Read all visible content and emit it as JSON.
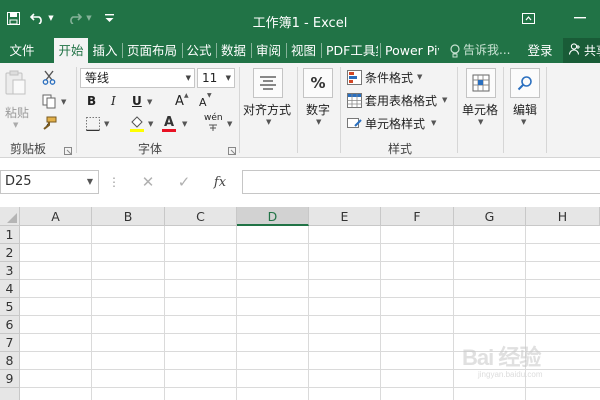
{
  "window": {
    "title": "工作簿1 - Excel",
    "accent_color": "#217346",
    "quick_access": {
      "save_icon": "save-icon",
      "undo_icon": "undo-icon",
      "redo_icon": "redo-icon",
      "customize_icon": "customize-qat-icon"
    },
    "controls": {
      "ribbon_display_icon": "ribbon-display-options-icon",
      "minimize_icon": "minimize-icon"
    }
  },
  "tabs": {
    "items": [
      "文件",
      "开始",
      "插入",
      "页面布局",
      "公式",
      "数据",
      "审阅",
      "视图",
      "PDF工具集",
      "Power Pivot"
    ],
    "active": "开始",
    "tell_me": "告诉我...",
    "sign_in": "登录",
    "share": "共享"
  },
  "ribbon": {
    "clipboard": {
      "label": "剪贴板",
      "paste": "粘贴"
    },
    "font": {
      "label": "字体",
      "font_name": "等线",
      "font_size": "11",
      "bold": "B",
      "italic": "I",
      "underline": "U",
      "grow": "A",
      "shrink": "A",
      "font_color_letter": "A",
      "phonetic": "wén",
      "fill_color": "#ffff00",
      "font_color": "#e81123"
    },
    "alignment": {
      "label": "对齐方式"
    },
    "number": {
      "label": "数字",
      "symbol": "%"
    },
    "styles": {
      "label": "样式",
      "conditional_formatting": "条件格式",
      "format_as_table": "套用表格格式",
      "cell_styles": "单元格样式"
    },
    "cells": {
      "label": "单元格"
    },
    "editing": {
      "label": "编辑"
    }
  },
  "formula_bar": {
    "name_box": "D25",
    "cancel": "✕",
    "enter": "✓",
    "fx": "fx",
    "value": ""
  },
  "sheet": {
    "columns": [
      "A",
      "B",
      "C",
      "D",
      "E",
      "F",
      "G",
      "H"
    ],
    "selected_column": "D",
    "rows": [
      "1",
      "2",
      "3",
      "4",
      "5",
      "6",
      "7",
      "8",
      "9"
    ]
  },
  "watermark": {
    "text": "Bai 经验",
    "sub": "jingyan.baidu.com"
  }
}
